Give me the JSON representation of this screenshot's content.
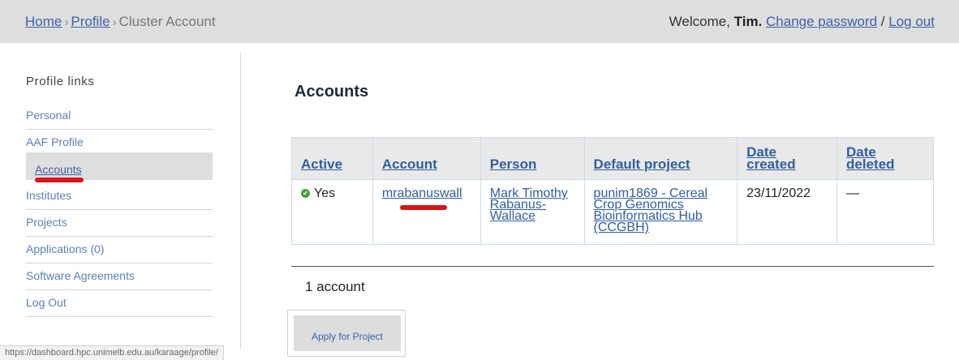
{
  "breadcrumb": {
    "home": "Home",
    "profile": "Profile",
    "current": "Cluster Account",
    "separator": "›"
  },
  "header": {
    "welcome_prefix": "Welcome,",
    "user_name": "Tim.",
    "change_password": "Change password",
    "slash": "/",
    "logout": "Log out"
  },
  "sidebar": {
    "title": "Profile links",
    "items": [
      {
        "label": "Personal"
      },
      {
        "label": "AAF Profile"
      },
      {
        "label": "Accounts"
      },
      {
        "label": "Institutes"
      },
      {
        "label": "Projects"
      },
      {
        "label": "Applications (0)"
      },
      {
        "label": "Software Agreements"
      },
      {
        "label": "Log Out"
      }
    ],
    "active": "Accounts"
  },
  "main": {
    "title": "Accounts",
    "table": {
      "headers": [
        "Active",
        "Account",
        "Person",
        "Default project",
        "Date created",
        "Date deleted"
      ],
      "rows": [
        {
          "active": "Yes",
          "account": "mrabanuswall",
          "person": "Mark Timothy Rabanus-Wallace",
          "default_project": "punim1869 - Cereal Crop Genomics Bioinformatics Hub (CCGBH)",
          "date_created": "23/11/2022",
          "date_deleted": "—"
        }
      ]
    },
    "count_text": "1 account",
    "apply_button": "Apply for Project"
  },
  "status_url": "https://dashboard.hpc.unimelb.edu.au/karaage/profile/",
  "colors": {
    "link": "#3d62a8",
    "topbar": "#dedede",
    "annotation_red": "#d8141c",
    "active_check": "#4aa03f"
  }
}
